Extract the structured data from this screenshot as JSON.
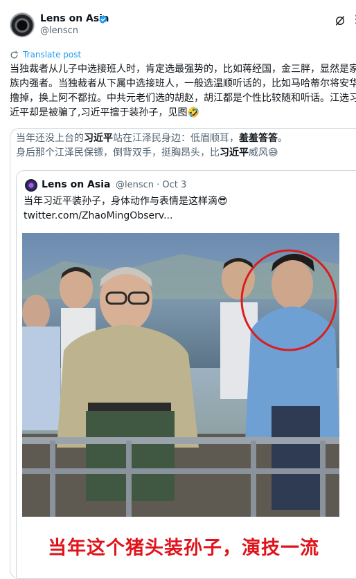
{
  "author": {
    "name": "Lens on Asia",
    "handle": "@lenscn"
  },
  "translate_label": "Translate post",
  "post_text": "当独裁者从儿子中选接班人时，肯定选最强势的，比如蒋经国，金三胖，显然是家族内强者。当独裁者从下属中选接班人，一般选温顺听话的，比如马哈蒂尔将安华撸掉，换上阿不都拉。中共元老们选的胡赵，胡江都是个性比较随和听话。江选习近平却是被骗了,习近平擅于装孙子，见图🤣",
  "quote": {
    "comment_line1_parts": [
      "当年还没上台的",
      "习近平",
      "站在江泽民身边：低眉顺耳，",
      "羞羞答答",
      "。"
    ],
    "comment_line2_parts": [
      "身后那个江泽民保镖，倒背双手，挺胸昂头，比",
      "习近平",
      "威风😅"
    ],
    "inner": {
      "name": "Lens on Asia",
      "meta": "@lenscn · Oct 3",
      "text": "当年习近平装孙子，身体动作与表情是这样滴😎",
      "link": "twitter.com/ZhaoMingObserv..."
    },
    "caption": "当年这个猪头装孙子，演技一流"
  },
  "colors": {
    "accent": "#1d9bf0",
    "caption_red": "#e0131b",
    "circle_red": "#d81e1e"
  },
  "icons": [
    "verified-badge-icon",
    "grok-icon",
    "more-icon",
    "translate-icon"
  ]
}
